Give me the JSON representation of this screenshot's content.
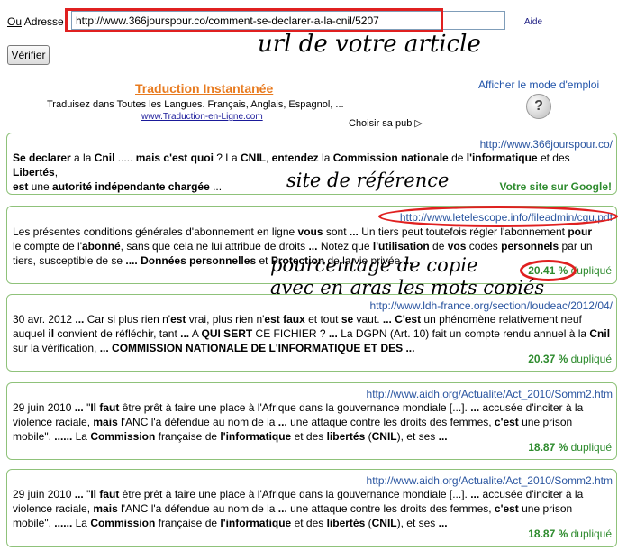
{
  "address": {
    "label_prefix": "Ou",
    "label": "Adresse",
    "value": "http://www.366jourspour.co/comment-se-declarer-a-la-cnil/5207",
    "aide": "Aide"
  },
  "verify_button": "Vérifier",
  "annotations": {
    "url": "url de votre article",
    "site": "site de référence",
    "pct": "pourcentage de copie",
    "bold": "avec en gras les mots copiés"
  },
  "translation": {
    "title": "Traduction Instantanée",
    "subtitle": "Traduisez dans Toutes les Langues. Français, Anglais, Espagnol, ...",
    "link": "www.Traduction-en-Ligne.com"
  },
  "mode_emploi": "Afficher le mode d'emploi",
  "help_icon": "question-mark-icon",
  "choisir_pub": "Choisir sa pub",
  "google_label": "Votre site sur Google!",
  "results": [
    {
      "url": "http://www.366jourspour.co/",
      "line1": "Se declarer a la Cnil ..... mais c'est quoi ? La CNIL, entendez la Commission nationale de l'informatique et des Libertés,",
      "line2": "est une autorité indépendante chargée ..."
    },
    {
      "url": "http://www.letelescope.info/fileadmin/cgu.pdf",
      "line1": "Les présentes conditions générales d'abonnement en ligne vous sont ... Un tiers peut toutefois régler l'abonnement pour",
      "line2": "le compte de l'abonné, sans que cela ne lui attribue de droits ... Notez que l'utilisation de vos codes personnels par un",
      "line3": "tiers, susceptible de se .... Données personnelles et Protection de la vie privée ...",
      "pct": "20.41 %",
      "pct_label": "dupliqué"
    },
    {
      "url": "http://www.ldh-france.org/section/loudeac/2012/04/",
      "line1": "30 avr. 2012 ... Car si plus rien n'est vrai, plus rien n'est faux et tout se vaut. ... C'est un phénomène relativement neuf",
      "line2": "auquel il convient de réfléchir, tant ... A QUI SERT CE FICHIER ? ... La DGPN (Art. 10) fait un compte rendu annuel à la Cnil",
      "line3": "sur la vérification, ... COMMISSION NATIONALE DE L'INFORMATIQUE ET DES ...",
      "pct": "20.37 %",
      "pct_label": "dupliqué"
    },
    {
      "url": "http://www.aidh.org/Actualite/Act_2010/Somm2.htm",
      "line1": "29 juin 2010 ... \"Il faut être prêt à faire une place à l'Afrique dans la gouvernance mondiale [...]. ... accusée d'inciter à la",
      "line2": "violence raciale, mais l'ANC l'a défendue au nom de la ... une attaque contre les droits des femmes, c'est une prison",
      "line3": "mobile\". ...... La Commission française de l'informatique et des libertés (CNIL), et ses ...",
      "pct": "18.87 %",
      "pct_label": "dupliqué"
    },
    {
      "url": "http://www.aidh.org/Actualite/Act_2010/Somm2.htm",
      "line1": "29 juin 2010 ... \"Il faut être prêt à faire une place à l'Afrique dans la gouvernance mondiale [...]. ... accusée d'inciter à la",
      "line2": "violence raciale, mais l'ANC l'a défendue au nom de la ... une attaque contre les droits des femmes, c'est une prison",
      "line3": "mobile\". ...... La Commission française de l'informatique et des libertés (CNIL), et ses ...",
      "pct": "18.87 %",
      "pct_label": "dupliqué"
    }
  ],
  "colors": {
    "annotation_red": "#e02020",
    "result_border": "#8fc27a",
    "pct_green": "#2e8b2e",
    "link_blue": "#2a55a0",
    "translation_orange": "#e87a1e"
  }
}
